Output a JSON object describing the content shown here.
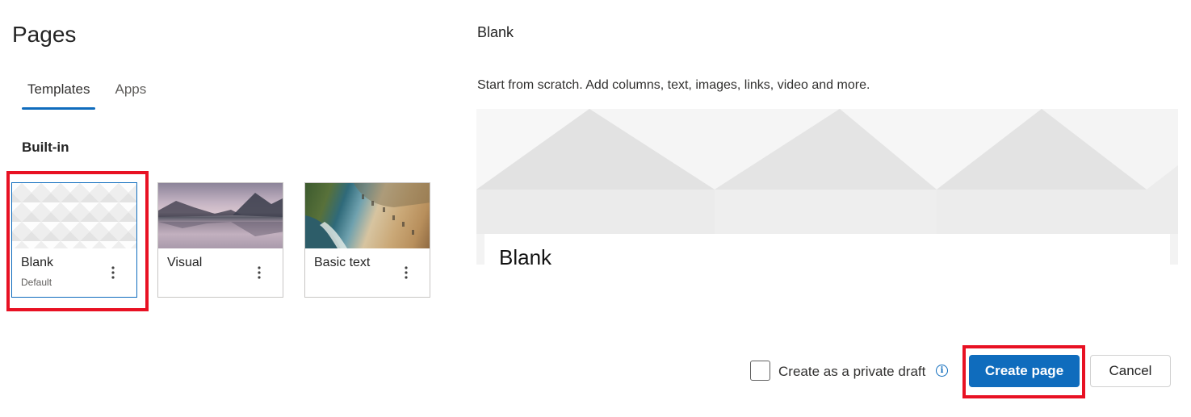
{
  "panel": {
    "title": "Pages"
  },
  "tabs": [
    {
      "label": "Templates",
      "active": true
    },
    {
      "label": "Apps",
      "active": false
    }
  ],
  "section_heading": "Built-in",
  "templates": [
    {
      "label": "Blank",
      "sublabel": "Default",
      "selected": true,
      "thumbnail": "white-geometric-pattern"
    },
    {
      "label": "Visual",
      "sublabel": "",
      "selected": false,
      "thumbnail": "mountain-lake-landscape"
    },
    {
      "label": "Basic text",
      "sublabel": "",
      "selected": false,
      "thumbnail": "aerial-beach-shoreline"
    }
  ],
  "preview": {
    "title": "Blank",
    "description": "Start from scratch. Add columns, text, images, links, video and more.",
    "card_title": "Blank"
  },
  "footer": {
    "private_draft_label": "Create as a private draft",
    "private_draft_checked": false,
    "create_label": "Create page",
    "cancel_label": "Cancel"
  },
  "colors": {
    "accent": "#0f6cbd",
    "highlight": "#e81123"
  },
  "icons": {
    "more": "more-vertical-icon",
    "info": "info-icon"
  }
}
